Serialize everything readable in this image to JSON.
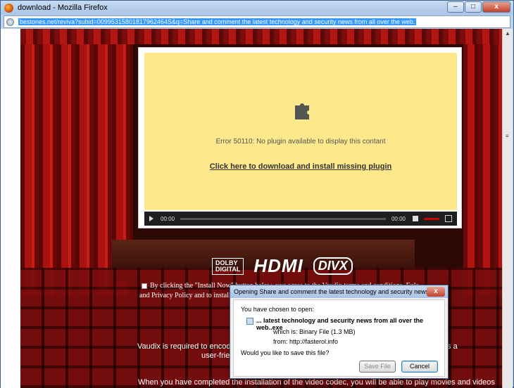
{
  "window": {
    "title": "download - Mozilla Firefox",
    "minimize_label": "–",
    "maximize_label": "□",
    "close_label": "x"
  },
  "urlbar": {
    "url": "bestones.net/reviva?subid=00995315801817962464S&q=Share and comment the latest technology and security news from all over the web."
  },
  "player": {
    "error_text": "Error 50110: No plugin available to display this contant",
    "download_link": "Click here to download and install missing plugin",
    "time_start": "00:00",
    "time_end": "00:00"
  },
  "logos": {
    "dolby_top": "DOLBY",
    "dolby_bottom": "DIGITAL",
    "hdmi": "HDMI",
    "divx": "DIVX"
  },
  "page": {
    "agree_line1": "By clicking the \"Install Now\" button below, you agree to the Vaudix terms and conditions, Eula",
    "agree_line2": "and Privacy Policy and to install",
    "text1": "Vaudix is required to encode a",
    "text2": "as a",
    "text3": "user-frie",
    "text4": "When you have completed the installation of the video codec, you will be able to play movies and videos"
  },
  "dialog": {
    "title": "Opening Share and comment the latest technology and security news ...",
    "close_label": "x",
    "chosen_text": "You have chosen to open:",
    "file_name": "... latest technology and security news from all over the web..exe",
    "which_is": "which is:  Binary File (1.3 MB)",
    "from": "from:  http://fasterol.info",
    "question": "Would you like to save this file?",
    "save_label": "Save File",
    "cancel_label": "Cancel"
  },
  "colors": {
    "screen_bg": "#fde88c",
    "curtain_red": "#b31510"
  }
}
